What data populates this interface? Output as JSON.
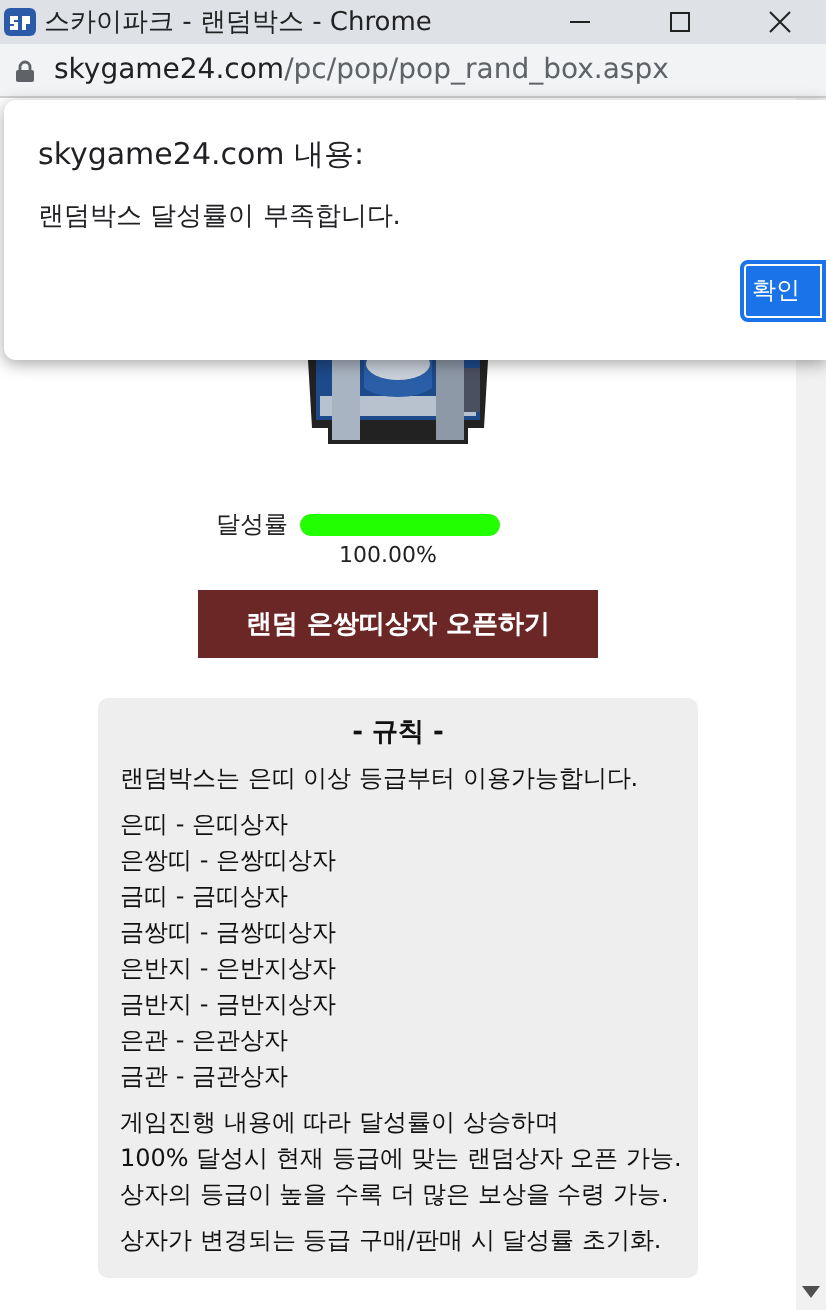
{
  "window": {
    "title": "스카이파크 - 랜덤박스 - Chrome",
    "url_host": "skygame24.com",
    "url_path": "/pc/pop/pop_rand_box.aspx"
  },
  "dialog": {
    "title": "skygame24.com 내용:",
    "message": "랜덤박스 달성률이 부족합니다.",
    "button": "확인"
  },
  "progress": {
    "label": "달성률",
    "level": 1,
    "reading": "100.00%"
  },
  "open_button": "랜덤 은쌍띠상자 오픈하기",
  "rules": {
    "title": "- 규칙 -",
    "groups": [
      [
        "랜덤박스는 은띠 이상 등급부터 이용가능합니다."
      ],
      [
        "은띠 - 은띠상자",
        "은쌍띠 - 은쌍띠상자",
        "금띠 - 금띠상자",
        "금쌍띠 - 금쌍띠상자",
        "은반지 - 은반지상자",
        "금반지 - 금반지상자",
        "은관 - 은관상자",
        "금관 - 금관상자"
      ],
      [
        "게임진행 내용에 따라 달성률이 상승하며",
        "100% 달성시 현재 등급에 맞는 랜덤상자 오픈 가능.",
        "상자의 등급이 높을 수록 더 많은 보상을 수령 가능."
      ],
      [
        "상자가 변경되는 등급 구매/판매 시 달성률 초기화."
      ]
    ]
  }
}
